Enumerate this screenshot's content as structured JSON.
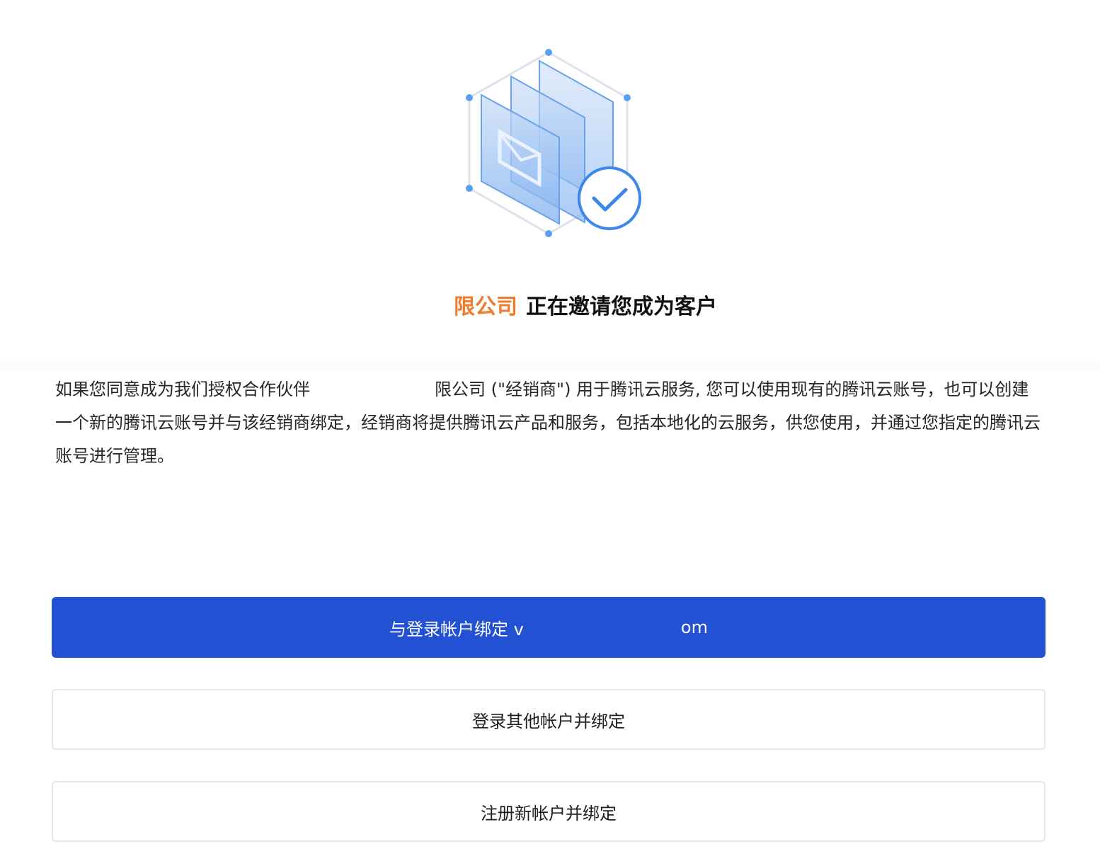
{
  "illustration": {
    "icon": "invite-envelope-check-icon",
    "accent": "#4a90e2"
  },
  "headline": {
    "company": "限公司",
    "rest": "正在邀请您成为客户",
    "company_color": "#ee7c2c"
  },
  "description": {
    "part1": "如果您同意成为我们授权合作伙伴",
    "part2": "限公司 (\"经销商\") 用于腾讯云服务, 您可以使用现有的腾讯云账号，也可以创建一个新的腾讯云账号并与该经销商绑定，经销商将提供腾讯云产品和服务，包括本地化的云服务，供您使用，并通过您指定的腾讯云账号进行管理。"
  },
  "actions": {
    "bind_current_prefix": "与登录帐户绑定 v",
    "bind_current_suffix": "om",
    "login_other": "登录其他帐户并绑定",
    "register_new": "注册新帐户并绑定",
    "primary_color": "#2251d3"
  }
}
